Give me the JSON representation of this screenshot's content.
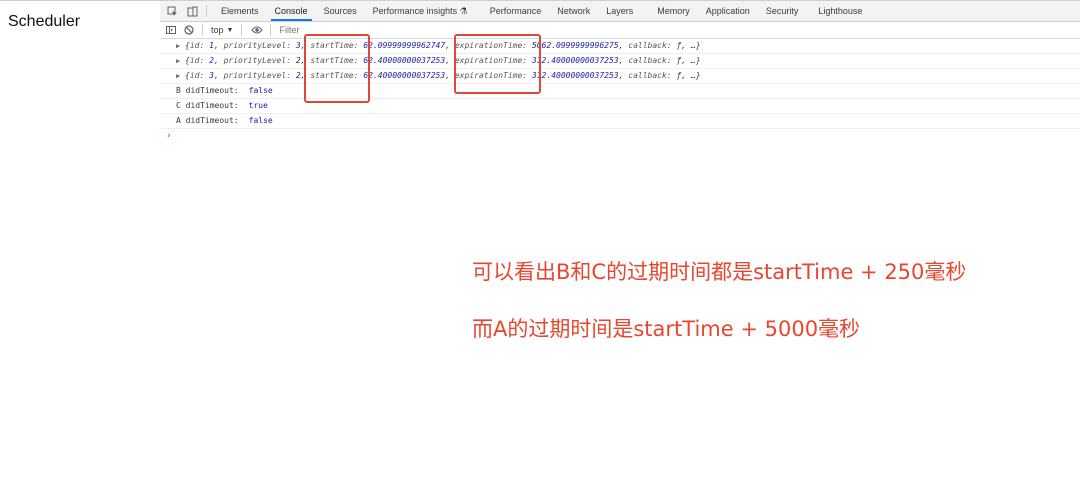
{
  "page_title": "Scheduler",
  "devtools": {
    "toolbar_icons": [
      "inspect-element-icon",
      "device-toggle-icon"
    ],
    "tabs": [
      {
        "label": "Elements",
        "active": false
      },
      {
        "label": "Console",
        "active": true
      },
      {
        "label": "Sources",
        "active": false
      },
      {
        "label": "Performance insights ⚗",
        "active": false
      },
      {
        "label": "Performance",
        "active": false
      },
      {
        "label": "Network",
        "active": false
      },
      {
        "label": "Layers",
        "active": false
      },
      {
        "label": "Memory",
        "active": false
      },
      {
        "label": "Application",
        "active": false
      },
      {
        "label": "Security",
        "active": false
      },
      {
        "label": "Lighthouse",
        "active": false
      }
    ],
    "console_toolbar": {
      "context": "top",
      "filter_placeholder": "Filter"
    }
  },
  "console": {
    "objects": [
      {
        "id": "1",
        "priorityLevel": "3",
        "startTime": "62.09999999962747",
        "expirationTime": "5062.0999999996275",
        "callback": "ƒ, …}"
      },
      {
        "id": "2",
        "priorityLevel": "2",
        "startTime": "62.40000000037253",
        "expirationTime": "312.40000000037253",
        "callback": "ƒ, …}"
      },
      {
        "id": "3",
        "priorityLevel": "2",
        "startTime": "62.40000000037253",
        "expirationTime": "312.40000000037253",
        "callback": "ƒ, …}"
      }
    ],
    "logs": [
      {
        "label": "B didTimeout:",
        "value": "false"
      },
      {
        "label": "C didTimeout:",
        "value": "true"
      },
      {
        "label": "A didTimeout:",
        "value": "false"
      }
    ],
    "prompt": "›"
  },
  "annotations": {
    "line1": "可以看出B和C的过期时间都是startTime + 250毫秒",
    "line2": "而A的过期时间是startTime + 5000毫秒"
  },
  "colors": {
    "annotation": "#e8462f",
    "highlight_box": "#e0463a",
    "active_tab": "#1a73e8"
  }
}
